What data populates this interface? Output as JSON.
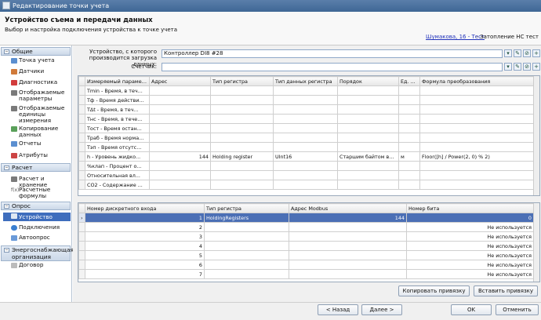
{
  "window": {
    "title": "Редактирование точки учета"
  },
  "header": {
    "title": "Устройство съема и передачи данных",
    "subtitle": "Выбор и настройка подключения устройства к точке учета",
    "link": "Шумакова, 16 - Тест",
    "extra": "- Затопление НС тест"
  },
  "sidebar": {
    "sections": [
      {
        "label": "Общие"
      },
      {
        "label": "Расчет"
      },
      {
        "label": "Опрос"
      },
      {
        "label": "Энергоснабжающая организация"
      }
    ],
    "items": [
      {
        "label": "Точка учета"
      },
      {
        "label": "Датчики"
      },
      {
        "label": "Диагностика"
      },
      {
        "label": "Отображаемые параметры"
      },
      {
        "label": "Отображаемые единицы измерения"
      },
      {
        "label": "Копирование данных"
      },
      {
        "label": "Отчеты"
      },
      {
        "label": "Атрибуты"
      },
      {
        "label": "Расчет и хранение"
      },
      {
        "label": "Расчетные формулы"
      },
      {
        "label": "Устройство"
      },
      {
        "label": "Подключения"
      },
      {
        "label": "Автоопрос"
      },
      {
        "label": "Договор"
      }
    ]
  },
  "form": {
    "device_label": "Устройство, с которого производится загрузка данных:",
    "device_value": "Контроллер DI8 #28",
    "counter_label": "Счетчик:",
    "counter_value": ""
  },
  "grid1": {
    "headers": [
      "Измеряемый параметр",
      "Адрес",
      "Тип регистра",
      "Тип данных регистра",
      "Порядок",
      "Ед. ...",
      "Формула преобразования"
    ],
    "rows": [
      [
        "Tmin - Время, в теч...",
        "",
        "",
        "",
        "",
        "",
        ""
      ],
      [
        "Tф - Время действи...",
        "",
        "",
        "",
        "",
        "",
        ""
      ],
      [
        "TΔt - Время, в теч...",
        "",
        "",
        "",
        "",
        "",
        ""
      ],
      [
        "Tнс - Время, в тече...",
        "",
        "",
        "",
        "",
        "",
        ""
      ],
      [
        "Tост - Время остан...",
        "",
        "",
        "",
        "",
        "",
        ""
      ],
      [
        "Tраб - Время норма...",
        "",
        "",
        "",
        "",
        "",
        ""
      ],
      [
        "Tэп - Время отсутс...",
        "",
        "",
        "",
        "",
        "",
        ""
      ],
      [
        "h - Уровень жидко...",
        "144",
        "Holding register",
        "UInt16",
        "Старшим байтом вперед",
        "м",
        "Floor([h] / Power(2, 0) % 2)"
      ],
      [
        "%клап - Процент о...",
        "",
        "",
        "",
        "",
        "",
        ""
      ],
      [
        "Относительная вл...",
        "",
        "",
        "",
        "",
        "",
        ""
      ],
      [
        "CO2 - Содержание ...",
        "",
        "",
        "",
        "",
        "",
        ""
      ]
    ]
  },
  "grid2": {
    "headers": [
      "Номер дискретного входа",
      "Тип регистра",
      "Адрес Modbus",
      "Номер бита"
    ],
    "rows": [
      [
        "1",
        "HoldingRegisters",
        "144",
        "0"
      ],
      [
        "2",
        "",
        "",
        "Не используется"
      ],
      [
        "3",
        "",
        "",
        "Не используется"
      ],
      [
        "4",
        "",
        "",
        "Не используется"
      ],
      [
        "5",
        "",
        "",
        "Не используется"
      ],
      [
        "6",
        "",
        "",
        "Не используется"
      ],
      [
        "7",
        "",
        "",
        "Не используется"
      ]
    ]
  },
  "buttons": {
    "copy": "Копировать привязку",
    "paste": "Вставить привязку",
    "back": "< Назад",
    "next": "Далее >",
    "ok": "OK",
    "cancel": "Отменить"
  }
}
